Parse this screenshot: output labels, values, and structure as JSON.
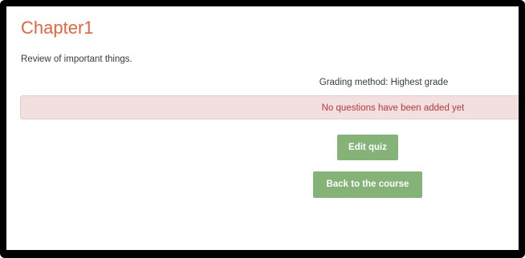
{
  "quiz": {
    "title": "Chapter1",
    "intro": "Review of important things.",
    "grading_method": "Grading method: Highest grade",
    "alert_message": "No questions have been added yet"
  },
  "buttons": {
    "edit_quiz": "Edit quiz",
    "back_to_course": "Back to the course"
  },
  "colors": {
    "title": "#e8643a",
    "alert_background": "#f4dfe0",
    "alert_text": "#b33a3a",
    "button_background": "#84b277",
    "button_text": "#ffffff",
    "frame_border": "#000000"
  }
}
